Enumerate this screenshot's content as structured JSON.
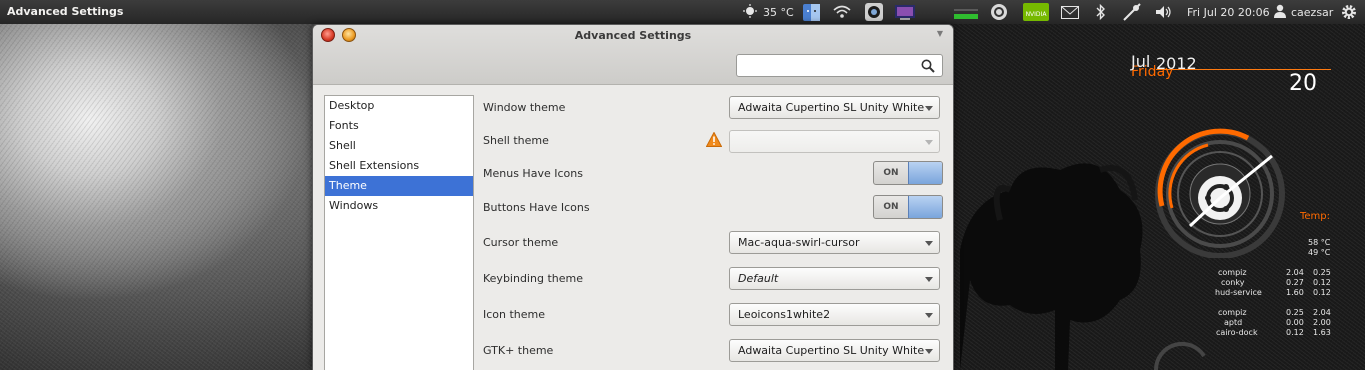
{
  "top_panel": {
    "app_title": "Advanced Settings",
    "temperature": "35 °C",
    "clock": "Fri Jul 20 20:06",
    "username": "caezsar",
    "icons": [
      "weather-icon",
      "finder-icon",
      "wifi-icon",
      "screenshot-icon",
      "monitor-icon",
      "network-meter-icon",
      "ubuntu-one-icon",
      "nvidia-icon",
      "mail-icon",
      "bluetooth-icon",
      "network-icon",
      "volume-icon",
      "user-icon",
      "gear-icon"
    ]
  },
  "window": {
    "title": "Advanced Settings",
    "search": {
      "value": "",
      "placeholder": ""
    },
    "sidebar": {
      "items": [
        {
          "label": "Desktop",
          "active": false
        },
        {
          "label": "Fonts",
          "active": false
        },
        {
          "label": "Shell",
          "active": false
        },
        {
          "label": "Shell Extensions",
          "active": false
        },
        {
          "label": "Theme",
          "active": true
        },
        {
          "label": "Windows",
          "active": false
        }
      ]
    },
    "settings": [
      {
        "label": "Window theme",
        "type": "combo",
        "value": "Adwaita Cupertino SL Unity White"
      },
      {
        "label": "Shell theme",
        "type": "combo",
        "value": "",
        "disabled": true,
        "warning": true
      },
      {
        "label": "Menus Have Icons",
        "type": "switch",
        "value": "ON"
      },
      {
        "label": "Buttons Have Icons",
        "type": "switch",
        "value": "ON"
      },
      {
        "label": "Cursor theme",
        "type": "combo",
        "value": "Mac-aqua-swirl-cursor"
      },
      {
        "label": "Keybinding theme",
        "type": "combo",
        "value": "Default",
        "italic": true
      },
      {
        "label": "Icon theme",
        "type": "combo",
        "value": "Leoicons1white2"
      },
      {
        "label": "GTK+ theme",
        "type": "combo",
        "value": "Adwaita Cupertino SL Unity White"
      }
    ]
  },
  "conky": {
    "month": "Jul",
    "year": "2012",
    "weekday": "Friday",
    "day": "20",
    "temp_label": "Temp:",
    "temps": [
      "58 °C",
      "49 °C"
    ],
    "cpu_processes": [
      {
        "name": "compiz",
        "a": "2.04",
        "b": "0.25"
      },
      {
        "name": "conky",
        "a": "0.27",
        "b": "0.12"
      },
      {
        "name": "hud-service",
        "a": "1.60",
        "b": "0.12"
      }
    ],
    "mem_processes": [
      {
        "name": "compiz",
        "a": "0.25",
        "b": "2.04"
      },
      {
        "name": "aptd",
        "a": "0.00",
        "b": "2.00"
      },
      {
        "name": "cairo-dock",
        "a": "0.12",
        "b": "1.63"
      }
    ]
  },
  "colors": {
    "accent": "#ff6a00",
    "selection": "#3d72d6",
    "panel": "#2e2e2e"
  }
}
